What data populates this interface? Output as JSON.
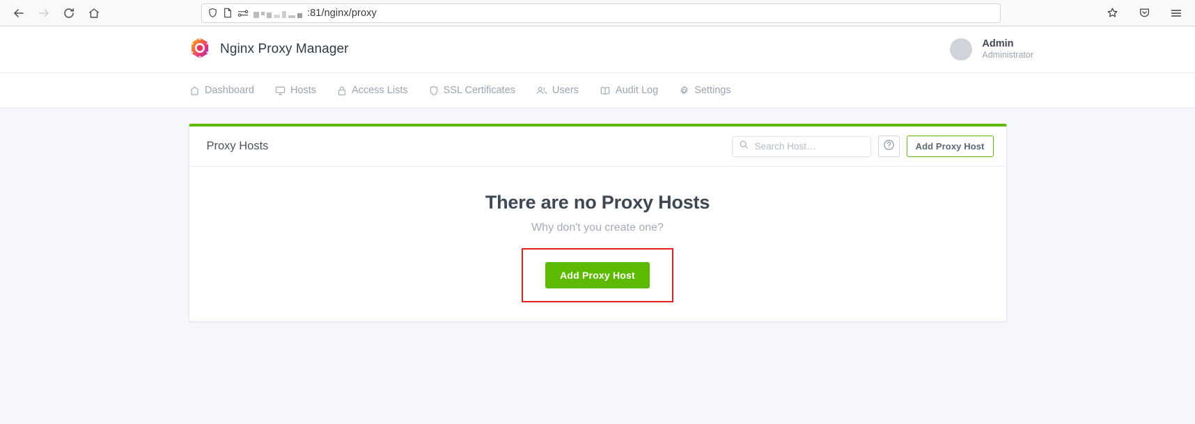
{
  "browser": {
    "back_icon": "back-arrow-icon",
    "forward_icon": "forward-arrow-icon",
    "reload_icon": "reload-icon",
    "home_icon": "home-icon",
    "shield_icon": "tracking-protection-shield-icon",
    "page_icon": "page-info-icon",
    "permissions_icon": "site-permissions-icon",
    "url_text": ":81/nginx/proxy",
    "url_redacted_note": "redacted-host-blocks",
    "bookmark_icon": "bookmark-star-icon",
    "pocket_icon": "save-to-pocket-icon",
    "menu_icon": "hamburger-menu-icon"
  },
  "app": {
    "logo_icon": "nginx-proxy-manager-hexagon-logo",
    "title": "Nginx Proxy Manager",
    "user": {
      "avatar_icon": "user-avatar-placeholder",
      "name": "Admin",
      "role": "Administrator"
    }
  },
  "nav": {
    "items": [
      {
        "label": "Dashboard",
        "icon": "home-icon"
      },
      {
        "label": "Hosts",
        "icon": "monitor-icon"
      },
      {
        "label": "Access Lists",
        "icon": "lock-icon"
      },
      {
        "label": "SSL Certificates",
        "icon": "shield-icon"
      },
      {
        "label": "Users",
        "icon": "users-icon"
      },
      {
        "label": "Audit Log",
        "icon": "book-icon"
      },
      {
        "label": "Settings",
        "icon": "gear-icon"
      }
    ]
  },
  "card": {
    "accent_color": "#5eba00",
    "title": "Proxy Hosts",
    "search": {
      "icon": "search-icon",
      "value": "",
      "placeholder": "Search Host…"
    },
    "help_button": {
      "icon": "help-circle-icon",
      "label": ""
    },
    "header_add_button": "Add Proxy Host",
    "empty_state": {
      "title": "There are no Proxy Hosts",
      "subtitle": "Why don't you create one?",
      "cta_label": "Add Proxy Host",
      "highlight_color": "#e81e1e"
    }
  }
}
